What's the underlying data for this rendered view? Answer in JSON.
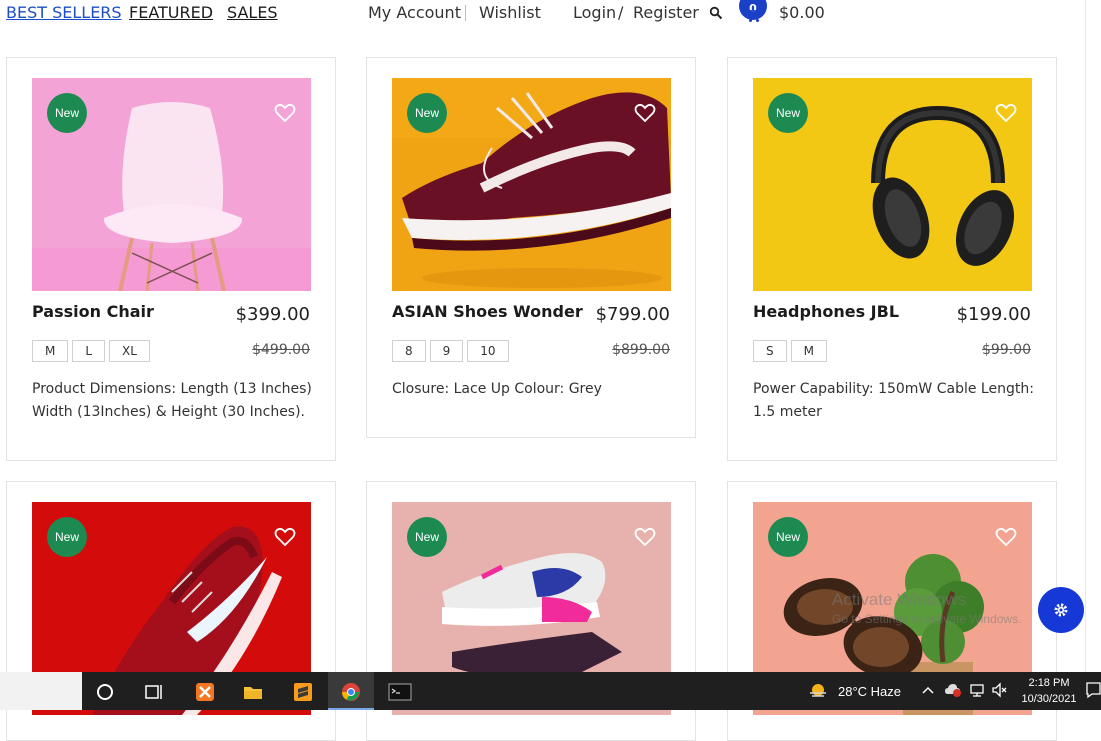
{
  "nav": {
    "links": [
      "BEST SELLERS",
      "FEATURED",
      "SALES"
    ],
    "my_account": "My Account",
    "wishlist": "Wishlist",
    "login": "Login",
    "slash": "/",
    "register": "Register",
    "cart_count": "0",
    "cart_total": "$0.00"
  },
  "products": [
    {
      "badge": "New",
      "name": "Passion Chair",
      "price": "$399.00",
      "old_price": "$499.00",
      "sizes": [
        "M",
        "L",
        "XL"
      ],
      "desc": "Product Dimensions: Length (13 Inches) Width (13Inches) & Height (30 Inches)."
    },
    {
      "badge": "New",
      "name": "ASIAN Shoes Wonder",
      "price": "$799.00",
      "old_price": "$899.00",
      "sizes": [
        "8",
        "9",
        "10"
      ],
      "desc": "Closure: Lace Up Colour: Grey"
    },
    {
      "badge": "New",
      "name": "Headphones JBL",
      "price": "$199.00",
      "old_price": "$99.00",
      "sizes": [
        "S",
        "M"
      ],
      "desc": "Power Capability: 150mW Cable Length: 1.5 meter"
    },
    {
      "badge": "New"
    },
    {
      "badge": "New"
    },
    {
      "badge": "New"
    }
  ],
  "watermark": {
    "line1": "Activate Windows",
    "line2": "Go to Settings to activate Windows."
  },
  "taskbar": {
    "weather": "28°C  Haze",
    "time": "2:18 PM",
    "date": "10/30/2021"
  },
  "colors": {
    "badge_green": "#1d8a52",
    "accent_blue": "#1a40c8",
    "active_link": "#1a4fc9"
  }
}
